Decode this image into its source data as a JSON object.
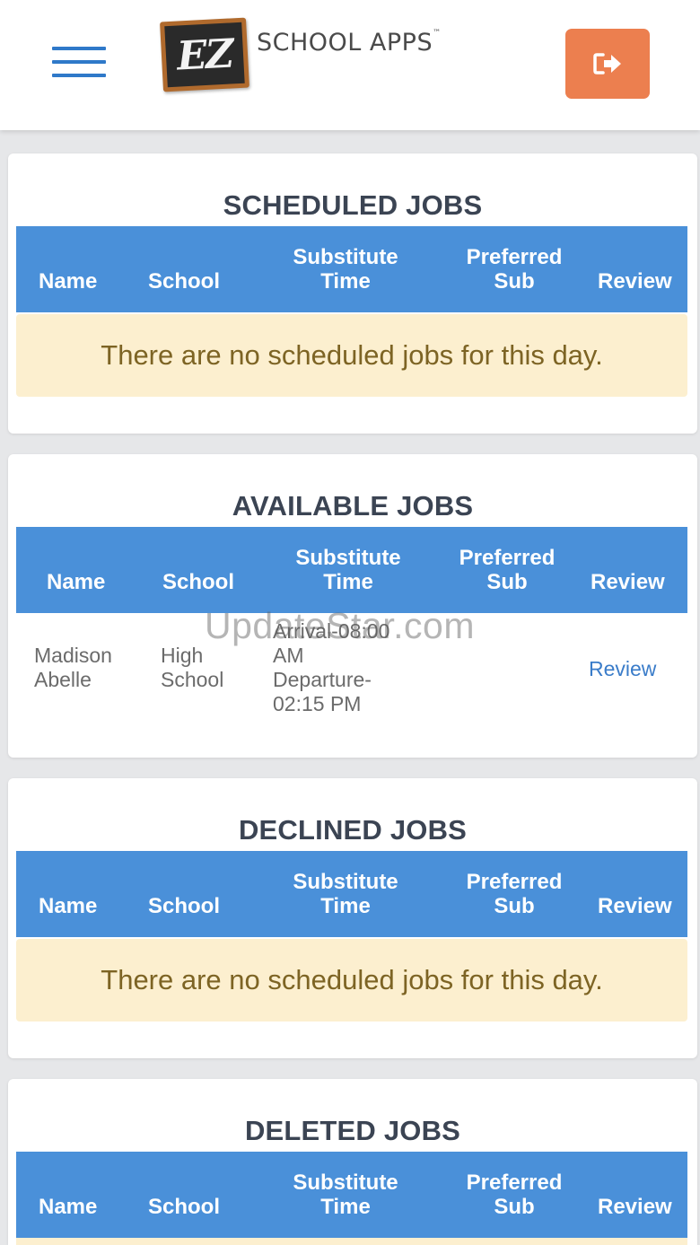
{
  "header": {
    "logo_mark": "EZ",
    "logo_text": "SCHOOL APPS",
    "logo_tm": "™"
  },
  "table_headers": {
    "name": "Name",
    "school": "School",
    "substitute_time_line1": "Substitute",
    "substitute_time_line2": "Time",
    "preferred_sub_line1": "Preferred",
    "preferred_sub_line2": "Sub",
    "review": "Review"
  },
  "sections": {
    "scheduled": {
      "title": "SCHEDULED JOBS",
      "empty_message": "There are no scheduled jobs for this day."
    },
    "available": {
      "title": "AVAILABLE JOBS",
      "rows": [
        {
          "name_line1": "Madison",
          "name_line2": "Abelle",
          "school_line1": "High",
          "school_line2": "School",
          "time_line1": "Arrival-08:00",
          "time_line2": "AM",
          "time_line3": "Departure-",
          "time_line4": "02:15 PM",
          "preferred_sub": "",
          "review_label": "Review"
        }
      ]
    },
    "declined": {
      "title": "DECLINED JOBS",
      "empty_message": "There are no scheduled jobs for this day."
    },
    "deleted": {
      "title": "DELETED JOBS"
    }
  },
  "watermark": "UpdateStar.com",
  "colors": {
    "table_header": "#4a90d9",
    "logout_button": "#ec7f4f",
    "menu_icon": "#2f79c9",
    "empty_alert_bg": "#fcefcf",
    "empty_alert_text": "#7d6424",
    "link": "#3a7cc9"
  },
  "icons": {
    "menu": "hamburger-menu-icon",
    "logout": "sign-out-icon"
  }
}
